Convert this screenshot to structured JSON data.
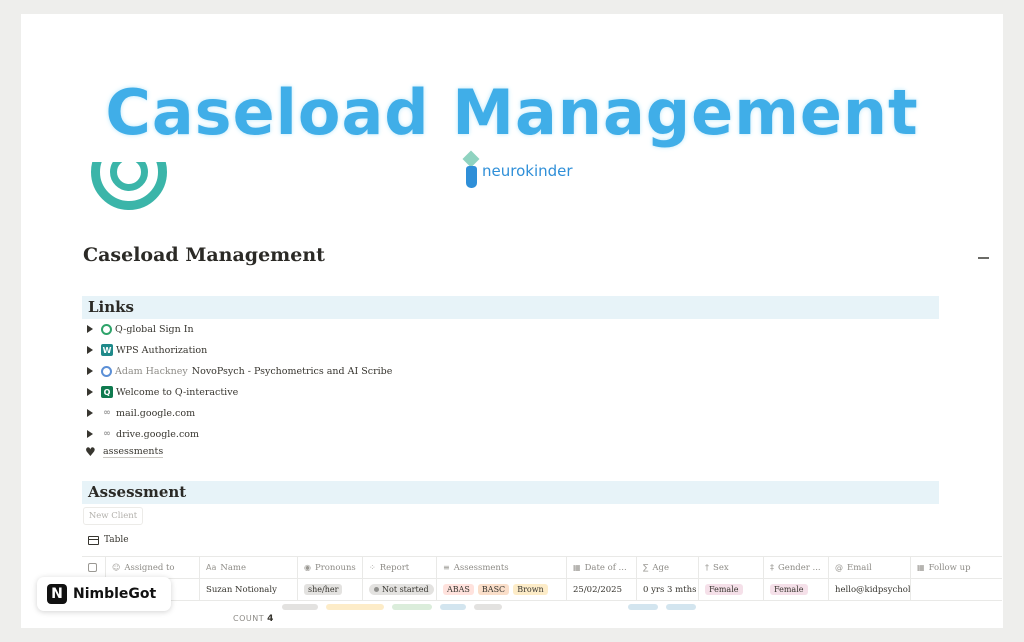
{
  "banner": {
    "title": "Caseload Management",
    "brand": "neurokinder"
  },
  "page": {
    "title": "Caseload Management"
  },
  "links_section": {
    "heading": "Links",
    "items": [
      {
        "icon": "q-global-icon",
        "prefix": "",
        "label": "Q-global Sign In"
      },
      {
        "icon": "wps-icon",
        "prefix": "",
        "label": "WPS Authorization"
      },
      {
        "icon": "novopsych-icon",
        "prefix": "Adam Hackney",
        "label": "NovoPsych - Psychometrics and AI Scribe"
      },
      {
        "icon": "q-interactive-icon",
        "prefix": "",
        "label": "Welcome to Q-interactive"
      },
      {
        "icon": "link-icon",
        "prefix": "",
        "label": "mail.google.com"
      },
      {
        "icon": "link-icon",
        "prefix": "",
        "label": "drive.google.com"
      }
    ],
    "heart_item": "assessments"
  },
  "assessment_section": {
    "heading": "Assessment",
    "new_button": "New Client",
    "view_tab": "Table",
    "columns": [
      "Assigned to",
      "Name",
      "Pronouns",
      "Report",
      "Assessments",
      "Date of ...",
      "Age",
      "Sex",
      "Gender ...",
      "Email",
      "Follow up"
    ],
    "rows": [
      {
        "assigned_to": "",
        "name": "Suzan Notionaly",
        "pronouns": "she/her",
        "report": "Not started",
        "assessments": [
          "ABAS",
          "BASC",
          "Brown"
        ],
        "date": "25/02/2025",
        "age": "0 yrs 3 mths",
        "sex": "Female",
        "gender": "Female",
        "email": "hello@kidpsycholog",
        "follow_up": ""
      }
    ],
    "count_label": "COUNT",
    "count_value": "4"
  },
  "watermark": {
    "label": "NimbleGot"
  },
  "colors": {
    "banner_title": "#40aee8",
    "section_bg": "#e7f3f8",
    "accent_teal": "#3bb5a9"
  }
}
